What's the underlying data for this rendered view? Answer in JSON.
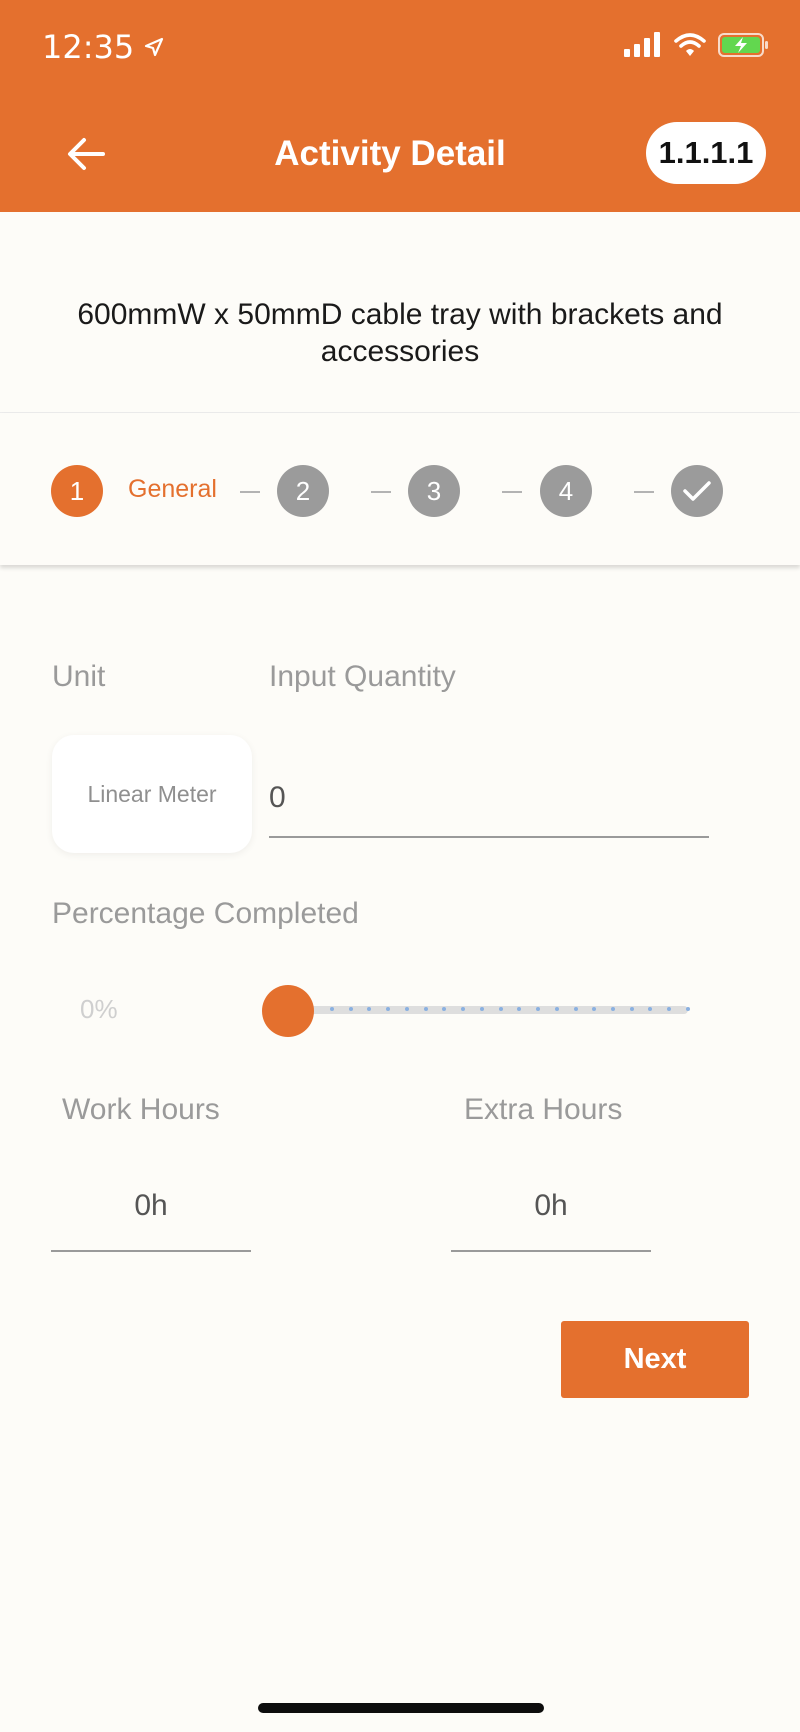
{
  "status_bar": {
    "time": "12:35",
    "icons": [
      "location-arrow-icon",
      "cellular-signal-icon",
      "wifi-icon",
      "battery-charging-icon"
    ]
  },
  "header": {
    "title": "Activity Detail",
    "version_badge": "1.1.1.1",
    "back_icon": "arrow-left-icon",
    "color": "#e4702e"
  },
  "description": "600mmW x 50mmD cable tray with brackets and accessories",
  "stepper": {
    "current_step": 1,
    "current_label": "General",
    "steps": [
      "1",
      "2",
      "3",
      "4"
    ],
    "final_step_icon": "check-icon"
  },
  "form": {
    "unit_label": "Unit",
    "unit_value": "Linear Meter",
    "quantity_label": "Input Quantity",
    "quantity_value": "0",
    "percentage_label": "Percentage Completed",
    "percentage_value": "0%",
    "percentage_fraction": 0,
    "work_hours_label": "Work Hours",
    "work_hours_value": "0h",
    "extra_hours_label": "Extra Hours",
    "extra_hours_value": "0h"
  },
  "actions": {
    "next_label": "Next"
  }
}
